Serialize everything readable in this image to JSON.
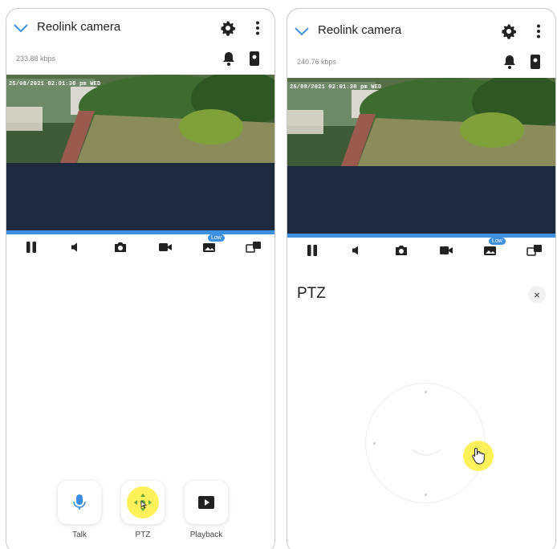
{
  "left": {
    "title": "Reolink camera",
    "bitrate": "233.88 kbps",
    "osd_timestamp": "25/08/2021 02:01:38 pm WED",
    "quality_badge": "Low",
    "actions": [
      {
        "label": "Talk",
        "icon": "microphone-icon"
      },
      {
        "label": "PTZ",
        "icon": "ptz-icon"
      },
      {
        "label": "Playback",
        "icon": "playback-icon"
      }
    ]
  },
  "right": {
    "title": "Reolink camera",
    "bitrate": "240.76 kbps",
    "osd_timestamp": "25/08/2021 02:01:38 pm WED",
    "quality_badge": "Low",
    "panel_title": "PTZ",
    "close_glyph": "×"
  },
  "toolbar_icons": [
    "pause-icon",
    "speaker-icon",
    "snapshot-icon",
    "record-icon",
    "quality-icon",
    "switch-view-icon"
  ],
  "colors": {
    "accent": "#3d8fe0",
    "highlight": "#ffee3c"
  }
}
